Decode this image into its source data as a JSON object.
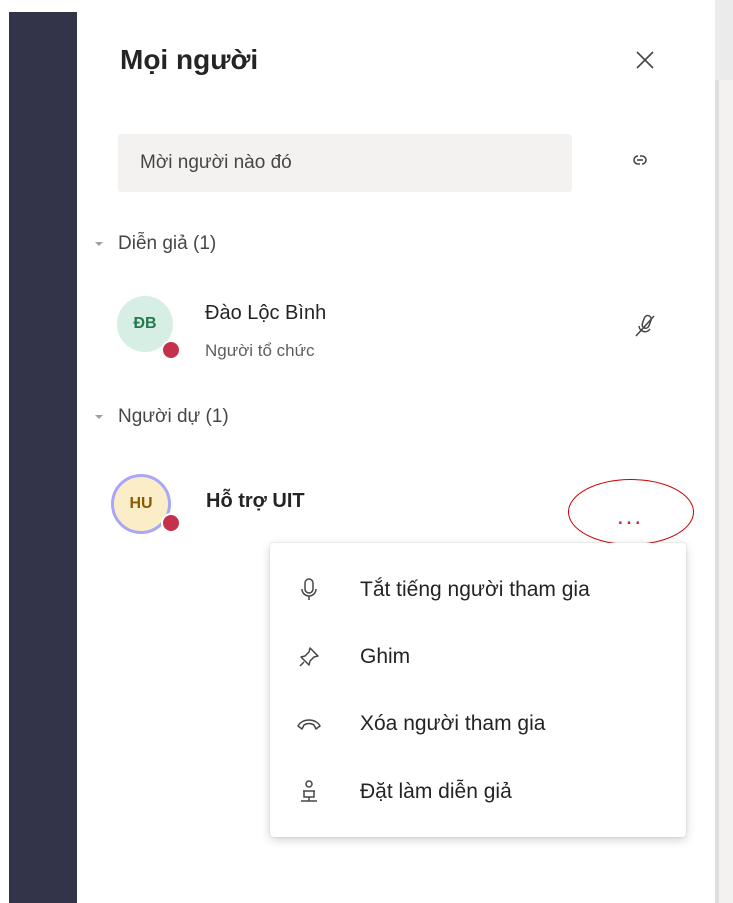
{
  "panel": {
    "title": "Mọi người",
    "invite_placeholder": "Mời người nào đó"
  },
  "sections": {
    "presenters": {
      "label": "Diễn giả (1)",
      "people": [
        {
          "initials": "ĐB",
          "name": "Đào Lộc Bình",
          "role": "Người tổ chức"
        }
      ]
    },
    "attendees": {
      "label": "Người dự (1)",
      "people": [
        {
          "initials": "HU",
          "name": "Hỗ trợ UIT"
        }
      ]
    }
  },
  "more_options": {
    "label": "..."
  },
  "context_menu": {
    "items": [
      {
        "label": "Tắt tiếng người tham gia",
        "icon": "microphone-icon"
      },
      {
        "label": "Ghim",
        "icon": "pin-icon"
      },
      {
        "label": "Xóa người tham gia",
        "icon": "hang-up-icon"
      },
      {
        "label": "Đặt làm diễn giả",
        "icon": "presenter-icon"
      }
    ]
  },
  "colors": {
    "rail": "#33344a",
    "status_busy": "#c4314b",
    "highlight": "#cc0000"
  }
}
